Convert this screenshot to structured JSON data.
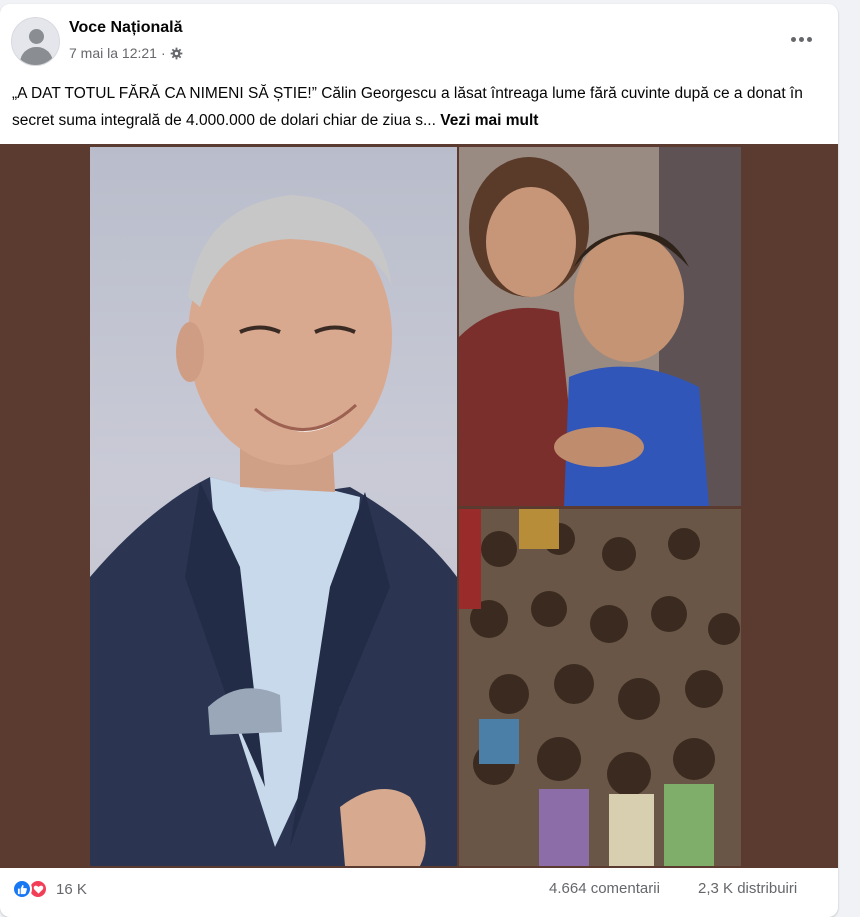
{
  "post": {
    "page_name": "Voce Națională",
    "timestamp": "7 mai la 12:21",
    "separator": "·",
    "text": "„A DAT TOTUL FĂRĂ CA NIMENI SĂ ȘTIE!” Călin Georgescu a lăsat întreaga lume fără cuvinte după ce a donat în secret suma integrală de 4.000.000 de dolari chiar de ziua s...",
    "see_more": "Vezi mai mult"
  },
  "icons": {
    "avatar": "default-avatar-icon",
    "audience": "gear-icon",
    "more": "more-options-icon",
    "like": "like-reaction-icon",
    "love": "love-reaction-icon"
  },
  "stats": {
    "reactions": "16 K",
    "comments": "4.664 comentarii",
    "shares": "2,3 K distribuiri"
  },
  "colors": {
    "accent": "#1877f2",
    "love": "#f33e58",
    "media_background": "#5b3b30",
    "secondary_text": "#65676b"
  }
}
